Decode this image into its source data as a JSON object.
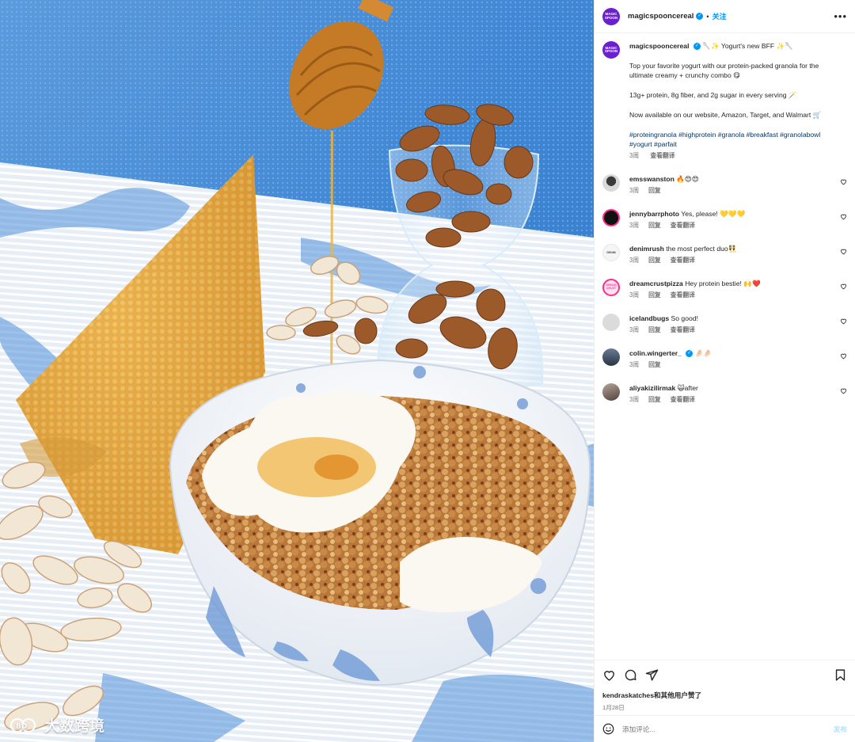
{
  "header": {
    "username": "magicspooncereal",
    "follow_label": "关注",
    "more_label": "•••"
  },
  "brand_avatar_text": "MAGIC\nSPOON",
  "caption": {
    "username": "magicspooncereal",
    "title": "🥄✨ Yogurt's new BFF ✨🥄",
    "line1": "Top your favorite yogurt with our protein-packed granola for the ultimate creamy + crunchy combo 😋",
    "line2": "13g+ protein, 8g fiber, and 2g sugar in every serving 🪄",
    "line3": "Now available on our website, Amazon, Target, and Walmart 🛒",
    "hashtags": "#proteingranola #highprotein #granola #breakfast #granolabowl #yogurt #parfait",
    "time": "3周",
    "translate": "查看翻译"
  },
  "comments": [
    {
      "username": "emsswanston",
      "text": "🔥😍😍",
      "time": "3周",
      "reply": "回复",
      "translate": ""
    },
    {
      "username": "jennybarrphoto",
      "text": "Yes, please! 💛💛💛",
      "time": "3周",
      "reply": "回复",
      "translate": "查看翻译"
    },
    {
      "username": "denimrush",
      "text": "the most perfect duo👯",
      "time": "3周",
      "reply": "回复",
      "translate": "查看翻译"
    },
    {
      "username": "dreamcrustpizza",
      "text": "Hey protein bestie! 🙌❤️",
      "time": "3周",
      "reply": "回复",
      "translate": "查看翻译"
    },
    {
      "username": "icelandbugs",
      "text": "So good!",
      "time": "3周",
      "reply": "回复",
      "translate": "查看翻译"
    },
    {
      "username": "colin.wingerter_",
      "text": "🤌🏻🤌🏻",
      "time": "3周",
      "reply": "回复",
      "translate": "",
      "verified": true
    },
    {
      "username": "aliyakizilirmak",
      "text": "🙀after",
      "time": "3周",
      "reply": "回复",
      "translate": "查看翻译"
    }
  ],
  "avatar_labels": {
    "denimrush": "DENIM",
    "dreamcrustpizza": "DREAM\nCRUST"
  },
  "likes": "kendraskatches和其他用户赞了",
  "date": "1月28日",
  "add_comment": {
    "placeholder": "添加评论...",
    "post_label": "发布"
  },
  "watermark": "大数跨境",
  "colors": {
    "brand_purple": "#6a1fd0",
    "link_blue": "#0095f6",
    "hashtag_blue": "#00376b",
    "muted": "#737373"
  }
}
